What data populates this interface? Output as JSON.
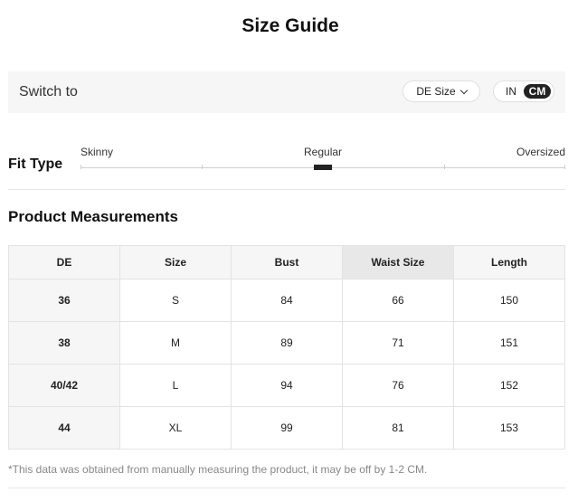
{
  "page_title": "Size Guide",
  "switch": {
    "label": "Switch to",
    "size_system": "DE Size",
    "units": [
      "IN",
      "CM"
    ],
    "active_unit": "CM"
  },
  "fit": {
    "label": "Fit Type",
    "options": [
      "Skinny",
      "Regular",
      "Oversized"
    ],
    "selected": "Regular"
  },
  "measurements": {
    "title": "Product Measurements",
    "columns": [
      "DE",
      "Size",
      "Bust",
      "Waist Size",
      "Length"
    ],
    "highlighted_column": "Waist Size",
    "rows": [
      [
        "36",
        "S",
        "84",
        "66",
        "150"
      ],
      [
        "38",
        "M",
        "89",
        "71",
        "151"
      ],
      [
        "40/42",
        "L",
        "94",
        "76",
        "152"
      ],
      [
        "44",
        "XL",
        "99",
        "81",
        "153"
      ]
    ]
  },
  "note": "*This data was obtained from manually measuring the product, it may be off by 1-2 CM."
}
